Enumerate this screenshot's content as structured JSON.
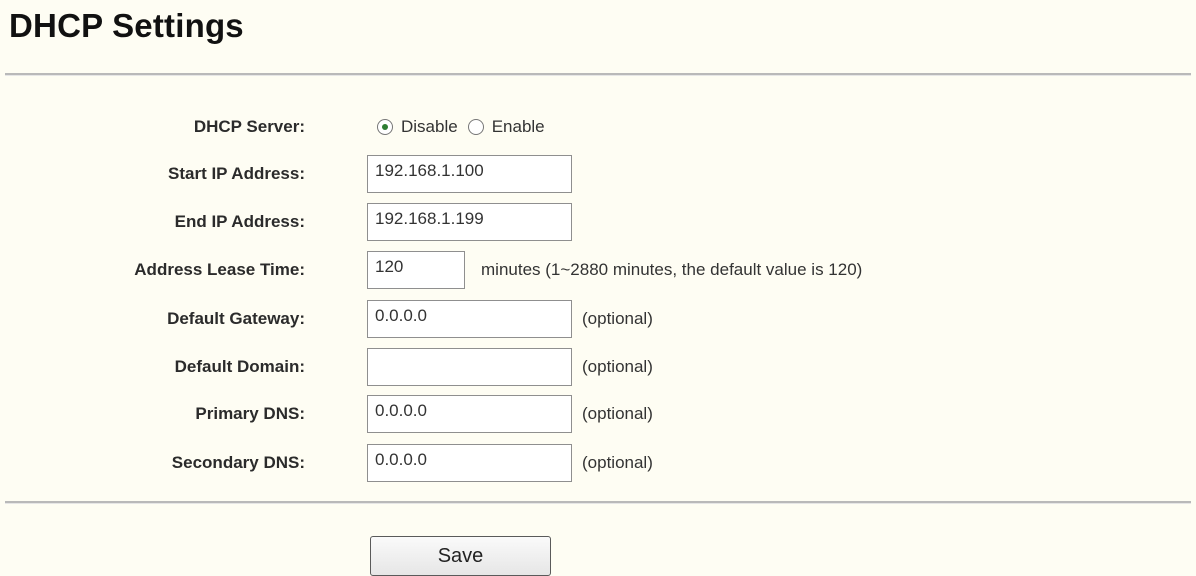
{
  "page": {
    "title": "DHCP Settings"
  },
  "form": {
    "dhcp_server": {
      "label": "DHCP Server:",
      "options": [
        {
          "label": "Disable",
          "checked": true
        },
        {
          "label": "Enable",
          "checked": false
        }
      ]
    },
    "start_ip": {
      "label": "Start IP Address:",
      "value": "192.168.1.100"
    },
    "end_ip": {
      "label": "End IP Address:",
      "value": "192.168.1.199"
    },
    "lease_time": {
      "label": "Address Lease Time:",
      "value": "120",
      "hint": "minutes (1~2880 minutes, the default value is 120)"
    },
    "default_gateway": {
      "label": "Default Gateway:",
      "value": "0.0.0.0",
      "hint": "(optional)"
    },
    "default_domain": {
      "label": "Default Domain:",
      "value": "",
      "hint": "(optional)"
    },
    "primary_dns": {
      "label": "Primary DNS:",
      "value": "0.0.0.0",
      "hint": "(optional)"
    },
    "secondary_dns": {
      "label": "Secondary DNS:",
      "value": "0.0.0.0",
      "hint": "(optional)"
    }
  },
  "actions": {
    "save_label": "Save"
  },
  "colors": {
    "background": "#fefdf3",
    "divider": "#b9b9b9",
    "radio_dot": "#2e7d32"
  }
}
